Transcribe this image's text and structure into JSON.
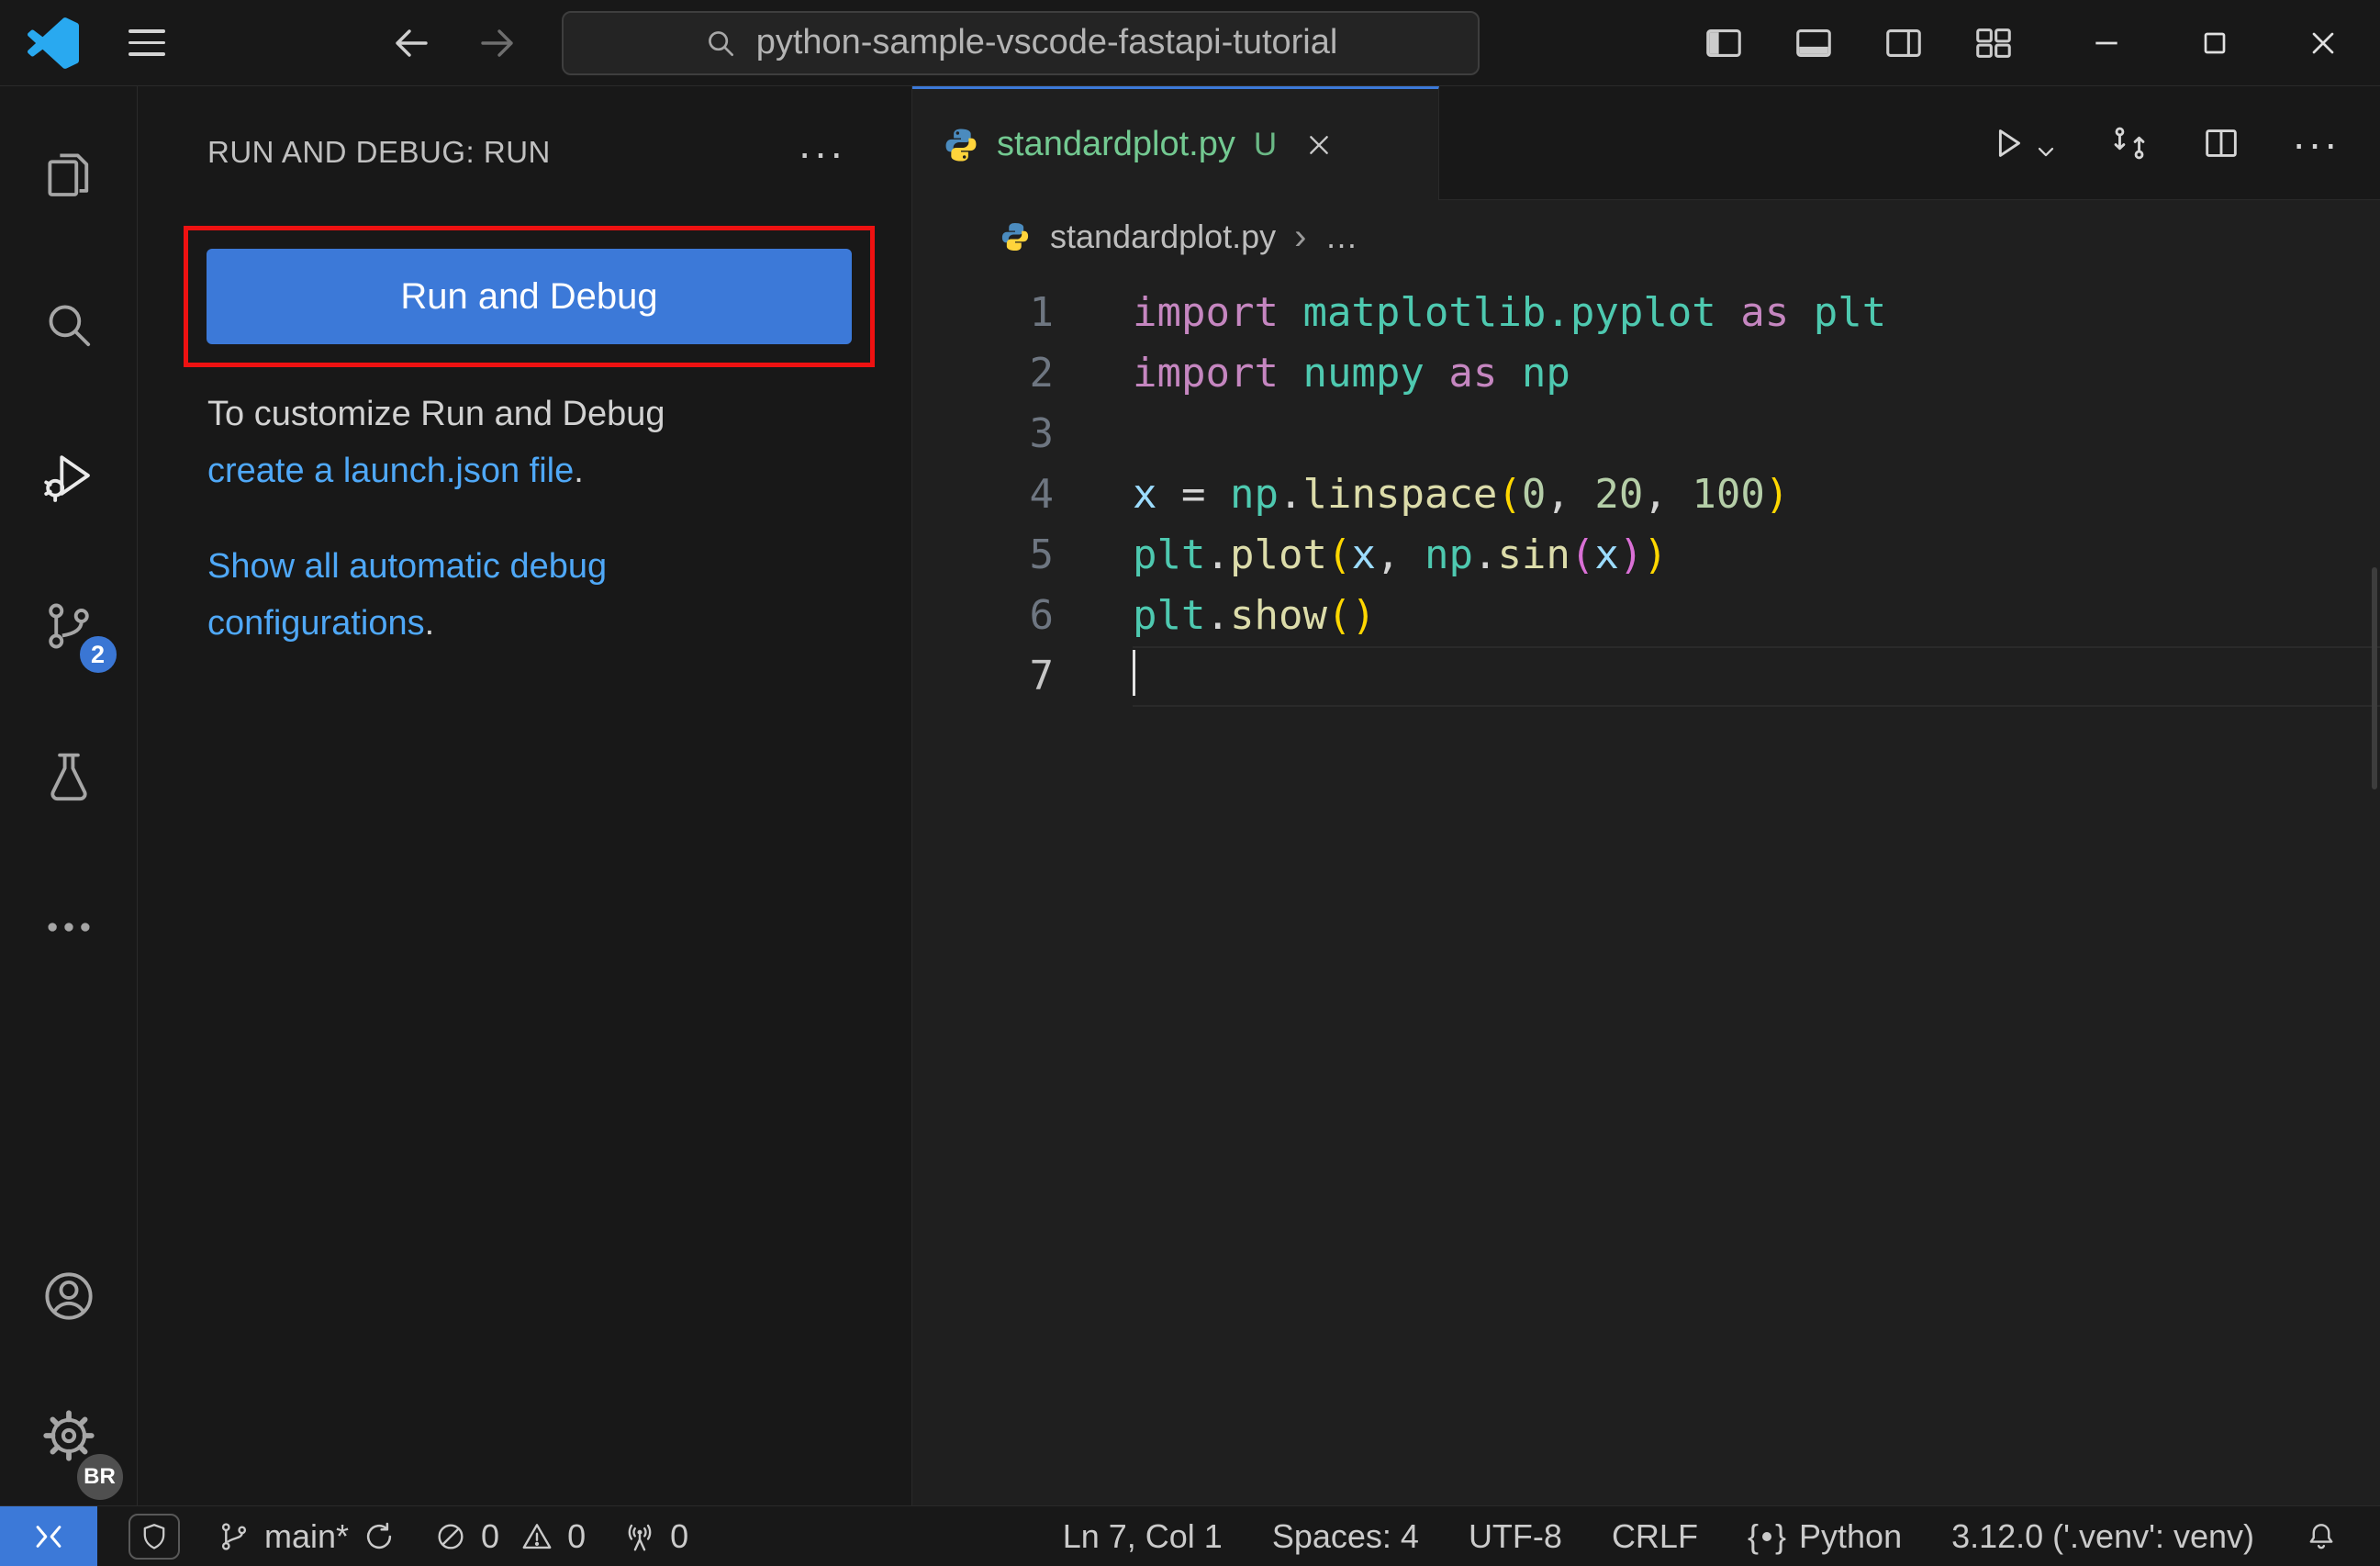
{
  "colors": {
    "accent_blue": "#3c79d8",
    "annotation_red": "#ee1111",
    "link_blue": "#4fa8f7",
    "untracked_green": "#73c991",
    "editor_background": "#1f1f1f",
    "chrome_background": "#181818"
  },
  "icons": {
    "more_horizontal": "···",
    "breadcrumb_chevron": "›",
    "breadcrumb_more": "…",
    "brace_left": "{",
    "brace_right": "}"
  },
  "title_bar": {
    "search_text": "python-sample-vscode-fastapi-tutorial"
  },
  "activity_bar": {
    "source_control_badge": "2",
    "settings_badge": "BR"
  },
  "sidebar": {
    "header": "RUN AND DEBUG: RUN",
    "run_button_label": "Run and Debug",
    "customize_line1": "To customize Run and Debug",
    "customize_link": "create a launch.json file",
    "customize_period": ".",
    "auto_link_line1": "Show all automatic debug",
    "auto_link_line2": "configurations",
    "auto_period": "."
  },
  "editor": {
    "tab_label": "standardplot.py",
    "tab_modified": "U",
    "breadcrumb_file": "standardplot.py",
    "cursor_line": 7,
    "code_lines": [
      [
        [
          "import",
          "kw"
        ],
        [
          " ",
          "pl"
        ],
        [
          "matplotlib.pyplot",
          "mod"
        ],
        [
          " ",
          "pl"
        ],
        [
          "as",
          "kw"
        ],
        [
          " ",
          "pl"
        ],
        [
          "plt",
          "mod"
        ]
      ],
      [
        [
          "import",
          "kw"
        ],
        [
          " ",
          "pl"
        ],
        [
          "numpy",
          "mod"
        ],
        [
          " ",
          "pl"
        ],
        [
          "as",
          "kw"
        ],
        [
          " ",
          "pl"
        ],
        [
          "np",
          "mod"
        ]
      ],
      [],
      [
        [
          "x",
          "var"
        ],
        [
          " ",
          "pl"
        ],
        [
          "=",
          "pl"
        ],
        [
          " ",
          "pl"
        ],
        [
          "np",
          "mod"
        ],
        [
          ".",
          "pl"
        ],
        [
          "linspace",
          "fn"
        ],
        [
          "(",
          "p1"
        ],
        [
          "0",
          "num"
        ],
        [
          ",",
          "pl"
        ],
        [
          " ",
          "pl"
        ],
        [
          "20",
          "num"
        ],
        [
          ",",
          "pl"
        ],
        [
          " ",
          "pl"
        ],
        [
          "100",
          "num"
        ],
        [
          ")",
          "p1"
        ]
      ],
      [
        [
          "plt",
          "mod"
        ],
        [
          ".",
          "pl"
        ],
        [
          "plot",
          "fn"
        ],
        [
          "(",
          "p1"
        ],
        [
          "x",
          "var"
        ],
        [
          ",",
          "pl"
        ],
        [
          " ",
          "pl"
        ],
        [
          "np",
          "mod"
        ],
        [
          ".",
          "pl"
        ],
        [
          "sin",
          "fn"
        ],
        [
          "(",
          "p2"
        ],
        [
          "x",
          "var"
        ],
        [
          ")",
          "p2"
        ],
        [
          ")",
          "p1"
        ]
      ],
      [
        [
          "plt",
          "mod"
        ],
        [
          ".",
          "pl"
        ],
        [
          "show",
          "fn"
        ],
        [
          "(",
          "p1"
        ],
        [
          ")",
          "p1"
        ]
      ],
      []
    ]
  },
  "status_bar": {
    "branch": "main*",
    "errors": "0",
    "warnings": "0",
    "ports": "0",
    "line_col": "Ln 7, Col 1",
    "spaces": "Spaces: 4",
    "encoding": "UTF-8",
    "eol": "CRLF",
    "language": "Python",
    "interpreter": "3.12.0 ('.venv': venv)"
  }
}
